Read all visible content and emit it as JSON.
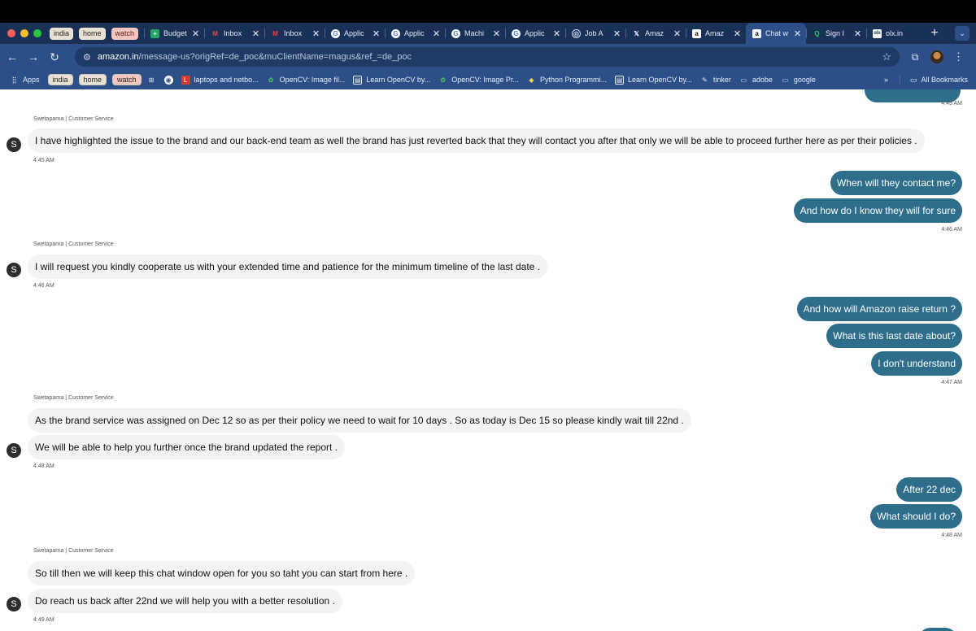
{
  "colors": {
    "tab_strip": "#1a3157",
    "toolbar": "#2c4f87",
    "agent_bubble": "#f3f3f3",
    "customer_bubble": "#2f6e8a"
  },
  "tab_groups": [
    {
      "label": "india"
    },
    {
      "label": "home"
    },
    {
      "label": "watch"
    }
  ],
  "tabs": [
    {
      "label": "Budget",
      "icon": "sheets-icon"
    },
    {
      "label": "Inbox",
      "icon": "gmail-icon"
    },
    {
      "label": "Inbox",
      "icon": "gmail-icon"
    },
    {
      "label": "Applic",
      "icon": "google-icon"
    },
    {
      "label": "Applic",
      "icon": "google-icon"
    },
    {
      "label": "Machi",
      "icon": "google-icon"
    },
    {
      "label": "Applic",
      "icon": "google-icon"
    },
    {
      "label": "Job A",
      "icon": "globe-icon"
    },
    {
      "label": "Amaz",
      "icon": "x-icon"
    },
    {
      "label": "Amaz",
      "icon": "amazon-icon"
    },
    {
      "label": "Chat w",
      "icon": "amazon-icon",
      "active": true
    },
    {
      "label": "Sign I",
      "icon": "q-icon"
    },
    {
      "label": "olx.in",
      "icon": "olx-icon"
    }
  ],
  "address_bar": {
    "host": "amazon.in",
    "path": "/message-us?origRef=de_poc&muClientName=magus&ref_=de_poc"
  },
  "bookmarks": {
    "apps": "Apps",
    "groups": [
      "india",
      "home",
      "watch"
    ],
    "items": [
      {
        "label": "laptops and netbo...",
        "icon": "l-icon"
      },
      {
        "label": "OpenCV: Image fil...",
        "icon": "opencv-icon"
      },
      {
        "label": "Learn OpenCV by...",
        "icon": "page-icon"
      },
      {
        "label": "OpenCV: Image Pr...",
        "icon": "opencv-icon"
      },
      {
        "label": "Python Programmi...",
        "icon": "python-icon"
      },
      {
        "label": "Learn OpenCV by...",
        "icon": "page-icon"
      },
      {
        "label": "tinker",
        "icon": "tinker-icon"
      },
      {
        "label": "adobe",
        "icon": "folder-icon"
      },
      {
        "label": "google",
        "icon": "folder-icon"
      }
    ],
    "more": "»",
    "all": "All Bookmarks"
  },
  "chat": {
    "agent_name": "Swetaparna | Customer Service",
    "avatar_letter": "S",
    "messages": [
      {
        "time": "4:45 AM"
      },
      {
        "text": "I have highlighted the issue to the brand and our back-end team as well the brand has just reverted back that they will contact you after that only we will be able to proceed further here as per their policies .",
        "time": "4:45 AM"
      },
      {
        "text": "When will they contact me?"
      },
      {
        "text": "And how do I know they will for sure",
        "time": "4:46 AM"
      },
      {
        "text": "I will request you kindly cooperate us with your extended time and patience for the minimum timeline of the last date .",
        "time": "4:46 AM"
      },
      {
        "text": "And how will Amazon raise return ?"
      },
      {
        "text": "What is this last date about?"
      },
      {
        "text": "I don't understand",
        "time": "4:47 AM"
      },
      {
        "text": "As the brand service was assigned on Dec 12 so as per their policy we need to wait for 10 days . So as today is Dec 15 so please kindly wait till 22nd ."
      },
      {
        "text": "We will be able to help you further once the brand updated the report .",
        "time": "4:48 AM"
      },
      {
        "text": "After 22 dec"
      },
      {
        "text": "What should I do?",
        "time": "4:48 AM"
      },
      {
        "text": "So till then we will keep this chat window open for you so taht you can start from here ."
      },
      {
        "text": "Do reach us back after 22nd we will help you with a better resolution .",
        "time": "4:49 AM"
      }
    ]
  }
}
